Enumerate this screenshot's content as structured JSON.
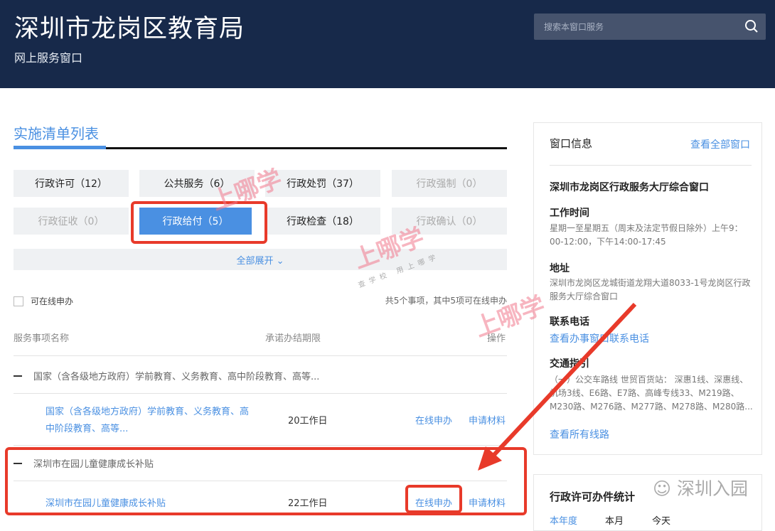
{
  "header": {
    "title": "深圳市龙岗区教育局",
    "subtitle": "网上服务窗口",
    "search_placeholder": "搜索本窗口服务"
  },
  "section": {
    "title": "实施清单列表"
  },
  "filters": [
    {
      "label": "行政许可（12）",
      "state": "normal"
    },
    {
      "label": "公共服务（6）",
      "state": "normal"
    },
    {
      "label": "行政处罚（37）",
      "state": "normal"
    },
    {
      "label": "行政强制（0）",
      "state": "disabled"
    },
    {
      "label": "行政征收（0）",
      "state": "disabled"
    },
    {
      "label": "行政给付（5）",
      "state": "active"
    },
    {
      "label": "行政检查（18）",
      "state": "normal"
    },
    {
      "label": "行政确认（0）",
      "state": "disabled"
    }
  ],
  "expand_label": "全部展开 ⌄",
  "online_checkbox": "可在线申办",
  "count_text": "共5个事项，其中5项可在线申办",
  "table": {
    "headers": [
      "服务事项名称",
      "承诺办结期限",
      "操作"
    ],
    "groups": [
      {
        "title": "国家（含各级地方政府）学前教育、义务教育、高中阶段教育、高等...",
        "item": "国家（含各级地方政府）学前教育、义务教育、高中阶段教育、高等...",
        "item_line1": "国家（含各级地方政府）学前教育、义务教育、高",
        "item_line2": "中阶段教育、高等...",
        "deadline": "20工作日",
        "action1": "在线申办",
        "action2": "申请材料"
      },
      {
        "title": "深圳市在园儿童健康成长补贴",
        "item": "深圳市在园儿童健康成长补贴",
        "deadline": "22工作日",
        "action1": "在线申办",
        "action2": "申请材料"
      }
    ]
  },
  "window_panel": {
    "title": "窗口信息",
    "view_all": "查看全部窗口",
    "name": "深圳市龙岗区行政服务大厅综合窗口",
    "hours_label": "工作时间",
    "hours": "星期一至星期五（周末及法定节假日除外）上午9：00-12:00，下午14:00-17:45",
    "address_label": "地址",
    "address": "深圳市龙岗区龙城街道龙翔大道8033-1号龙岗区行政服务大厅综合窗口",
    "phone_label": "联系电话",
    "phone_link": "查看办事窗口联系电话",
    "traffic_label": "交通指引",
    "traffic": "（一）公交车路线 世贸百货站： 深惠1线、深惠线、机场3线、E6路、E7路、高峰专线33、M219路、M230路、M276路、M277路、M278路、M280路...",
    "traffic_link": "查看所有线路"
  },
  "stats_panel": {
    "title": "行政许可办件统计",
    "tabs": [
      "本年度",
      "本月",
      "今天"
    ]
  },
  "watermarks": {
    "main": "上哪学",
    "sub": "查学校 用上哪学",
    "wechat": "深圳入园"
  },
  "colors": {
    "header": "#17294a",
    "accent": "#4a90e2",
    "highlight": "#e83a2a"
  }
}
